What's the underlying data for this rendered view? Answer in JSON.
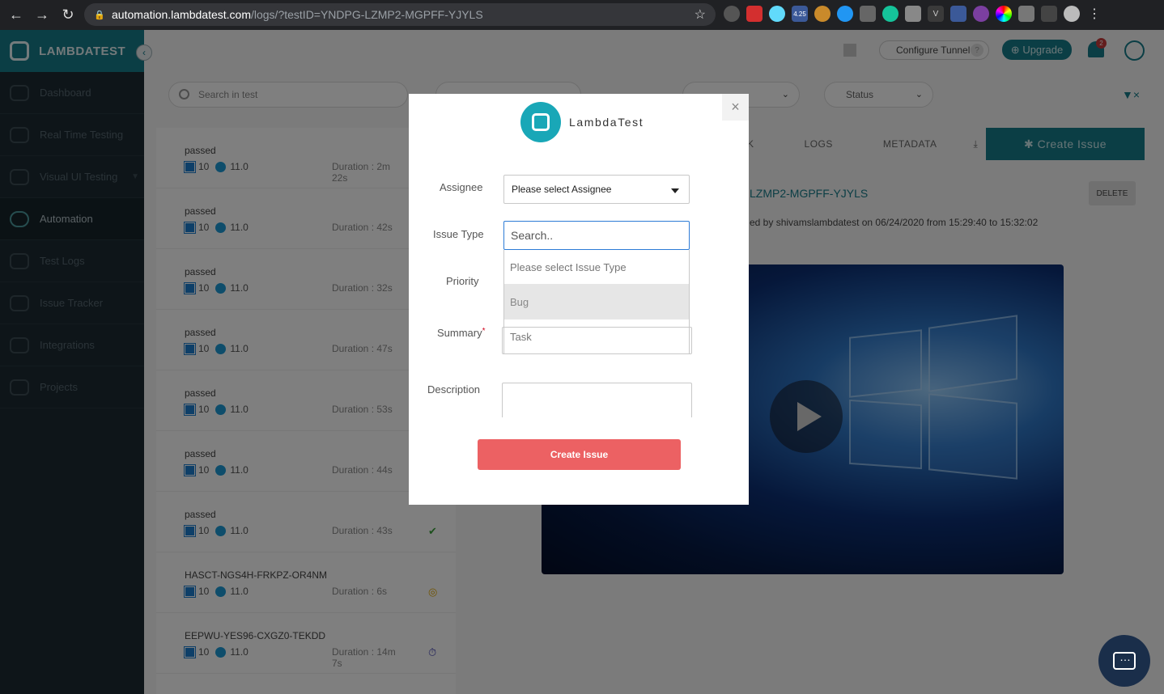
{
  "browser": {
    "url_host": "automation.lambdatest.com",
    "url_path": "/logs/?testID=YNDPG-LZMP2-MGPFF-YJYLS",
    "ext_badge": "4.25",
    "notif_count": "2"
  },
  "sidebar": {
    "logo": "LAMBDATEST",
    "items": [
      {
        "label": "Dashboard"
      },
      {
        "label": "Real Time Testing"
      },
      {
        "label": "Visual UI Testing"
      },
      {
        "label": "Automation"
      },
      {
        "label": "Test Logs"
      },
      {
        "label": "Issue Tracker"
      },
      {
        "label": "Integrations"
      },
      {
        "label": "Projects"
      }
    ]
  },
  "header": {
    "configure_tunnel": "Configure Tunnel",
    "tunnel_help": "?",
    "upgrade": "Upgrade"
  },
  "filters": {
    "search_placeholder": "Search in test",
    "status": "Status"
  },
  "tests": [
    {
      "status": "passed",
      "os": "10",
      "browser": "11.0",
      "duration": "Duration : 2m 22s"
    },
    {
      "status": "passed",
      "os": "10",
      "browser": "11.0",
      "duration": "Duration : 42s"
    },
    {
      "status": "passed",
      "os": "10",
      "browser": "11.0",
      "duration": "Duration : 32s"
    },
    {
      "status": "passed",
      "os": "10",
      "browser": "11.0",
      "duration": "Duration : 47s"
    },
    {
      "status": "passed",
      "os": "10",
      "browser": "11.0",
      "duration": "Duration : 53s"
    },
    {
      "status": "passed",
      "os": "10",
      "browser": "11.0",
      "duration": "Duration : 44s"
    },
    {
      "status": "passed",
      "os": "10",
      "browser": "11.0",
      "duration": "Duration : 43s"
    },
    {
      "status": "HASCT-NGS4H-FRKPZ-OR4NM",
      "os": "10",
      "browser": "11.0",
      "duration": "Duration : 6s"
    },
    {
      "status": "EEPWU-YES96-CXGZ0-TEKDD",
      "os": "10",
      "browser": "11.0",
      "duration": "Duration : 14m 7s"
    }
  ],
  "detail": {
    "tabs": [
      "K",
      "LOGS",
      "METADATA"
    ],
    "create_issue": "Create Issue",
    "test_id_fragment": "LZMP2-MGPFF-YJYLS",
    "delete": "DELETE",
    "byline": "ed by shivamslambdatest on 06/24/2020 from 15:29:40 to 15:32:02"
  },
  "modal": {
    "brand": "LambdaTest",
    "assignee_label": "Assignee",
    "assignee_value": "Please select Assignee",
    "issue_type_label": "Issue Type",
    "issue_search_placeholder": "Search..",
    "issue_type_options": [
      "Please select Issue Type",
      "Bug",
      "Task"
    ],
    "priority_label": "Priority",
    "summary_label": "Summary",
    "required_mark": "*",
    "description_label": "Description",
    "submit": "Create Issue"
  }
}
